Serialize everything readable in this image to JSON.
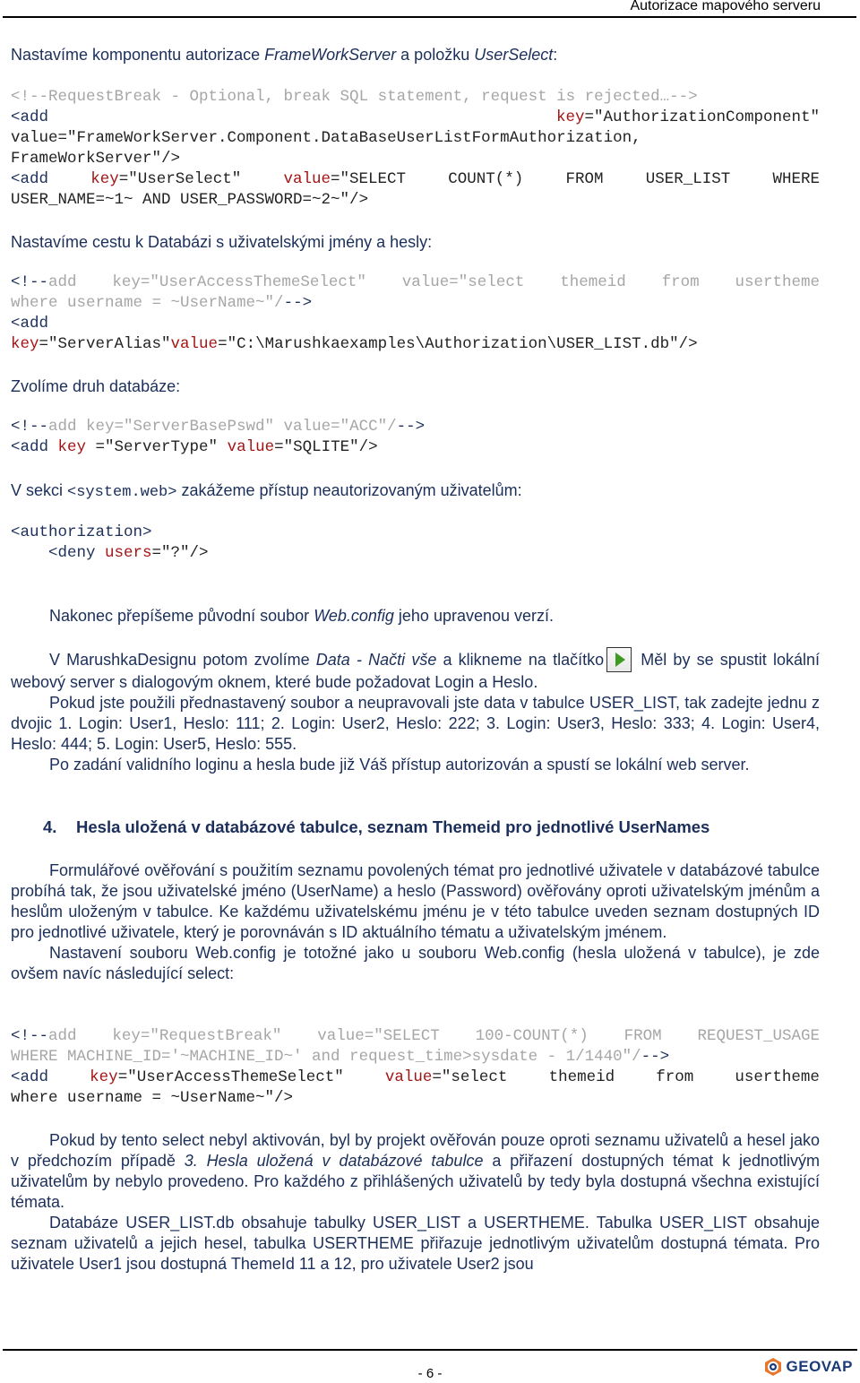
{
  "header": {
    "title": "Autorizace mapového serveru"
  },
  "sections": {
    "intro1": {
      "before": "Nastavíme komponentu autorizace ",
      "em1": "FrameWorkServer",
      "mid": " a položku ",
      "em2": "UserSelect",
      "after": ":"
    },
    "code1": {
      "l1_comment": "<!--RequestBreak - Optional, break SQL statement, request is rejected…-->",
      "l2_tag": "<add",
      "l2_attr": "key",
      "l2_val": "=\"AuthorizationComponent\"",
      "l3": "value=\"FrameWorkServer.Component.DataBaseUserListFormAuthorization,",
      "l4": "FrameWorkServer\"/>",
      "l5_tag": "<add",
      "l5_attr1": "key",
      "l5_val1": "=\"UserSelect\"",
      "l5_attr2": "value",
      "l5_val2": "=\"SELECT",
      "l5_w1": "COUNT(*)",
      "l5_w2": "FROM",
      "l5_w3": "USER_LIST",
      "l5_w4": "WHERE",
      "l6": "USER_NAME=~1~ AND USER_PASSWORD=~2~\"/>"
    },
    "intro2": "Nastavíme cestu k Databázi s uživatelskými jmény a hesly:",
    "code2": {
      "l1_open": "<!--",
      "l1_words": [
        "add",
        "key=\"UserAccessThemeSelect\"",
        "value=\"select",
        "themeid",
        "from",
        "usertheme"
      ],
      "l2_comment": "where username = ~UserName~\"/",
      "l2_close": "-->",
      "l3_tag": "<add",
      "l4_attr1": "key",
      "l4_val1": "=\"ServerAlias\"",
      "l4_attr2": "value",
      "l4_val2": "=\"C:\\Marushkaexamples\\Authorization\\USER_LIST.db\"/>"
    },
    "intro3": "Zvolíme druh databáze:",
    "code3": {
      "l1_open": "<!--",
      "l1_comment": "add key=\"ServerBasePswd\" value=\"ACC\"/",
      "l1_close": "-->",
      "l2_tag": "<add ",
      "l2_attr1": "key",
      "l2_val1": " =\"ServerType\" ",
      "l2_attr2": "value",
      "l2_val2": "=\"SQLITE\"/>"
    },
    "intro4": {
      "before": "V sekci ",
      "code": "<system.web>",
      "after": " zakážeme přístup neautorizovaným uživatelům:"
    },
    "code4": {
      "l1": "<authorization>",
      "l2_tag": "    <deny ",
      "l2_attr": "users",
      "l2_val": "=\"?\"/>"
    },
    "para1": {
      "before": "Nakonec přepíšeme původní soubor ",
      "em": "Web.config",
      "after": " jeho upravenou verzí."
    },
    "para2": {
      "before": "V MarushkaDesignu potom zvolíme ",
      "em": "Data - Načti vše",
      "mid": " a klikneme na tlačítko",
      "after": " Měl by se spustit lokální webový server s dialogovým oknem, které bude požadovat Login a Heslo."
    },
    "para3": "Pokud jste použili přednastavený soubor a neupravovali jste data v tabulce USER_LIST, tak zadejte jednu z dvojic 1. Login: User1, Heslo: 111; 2. Login: User2, Heslo: 222; 3. Login: User3, Heslo: 333; 4. Login: User4, Heslo: 444; 5. Login: User5, Heslo: 555.",
    "para4": "Po zadání validního loginu a hesla bude již Váš přístup autorizován a spustí se lokální web server.",
    "heading4": {
      "number": "4.",
      "text": "Hesla uložená v databázové tabulce, seznam Themeid pro jednotlivé UserNames"
    },
    "para5": "Formulářové ověřování s použitím seznamu povolených témat pro jednotlivé uživatele v databázové tabulce probíhá tak, že jsou uživatelské jméno (UserName) a heslo (Password) ověřovány oproti uživatelským jménům a heslům uloženým v tabulce. Ke každému uživatelskému jménu je v této tabulce uveden seznam dostupných ID pro jednotlivé uživatele, který je porovnáván s ID aktuálního tématu a uživatelským jménem.",
    "para6": "Nastavení souboru Web.config je totožné jako u souboru Web.config (hesla uložená v tabulce), je zde ovšem navíc následující select:",
    "code5": {
      "l1_open": "<!--",
      "l1_words": [
        "add",
        "key=\"RequestBreak\"",
        "value=\"SELECT",
        "100-COUNT(*)",
        "FROM",
        "REQUEST_USAGE"
      ],
      "l2_comment": "WHERE MACHINE_ID='~MACHINE_ID~' and request_time>sysdate - 1/1440\"/",
      "l2_close": "-->",
      "l3_tag": "<add",
      "l3_attr1": "key",
      "l3_val1": "=\"UserAccessThemeSelect\"",
      "l3_attr2": "value",
      "l3_val2": "=\"select",
      "l3_w1": "themeid",
      "l3_w2": "from",
      "l3_w3": "usertheme",
      "l4": "where username = ~UserName~\"/>"
    },
    "para7": {
      "before": "Pokud by tento select nebyl aktivován, byl by projekt ověřován pouze oproti seznamu uživatelů a hesel jako v předchozím případě ",
      "em": "3. Hesla uložená v databázové tabulce",
      "after": " a přiřazení dostupných témat k jednotlivým uživatelům by nebylo provedeno. Pro každého z přihlášených uživatelů by tedy byla dostupná všechna existující témata."
    },
    "para8": "Databáze USER_LIST.db obsahuje tabulky USER_LIST a USERTHEME. Tabulka USER_LIST obsahuje seznam uživatelů a jejich hesel, tabulka USERTHEME přiřazuje jednotlivým uživatelům dostupná témata. Pro uživatele User1 jsou dostupná ThemeId 11 a 12, pro uživatele User2 jsou"
  },
  "footer": {
    "page": "- 6 -",
    "logo": "GEOVAP"
  },
  "icons": {
    "run_button": "play-icon",
    "logo_mark": "geovap-logo-icon"
  }
}
